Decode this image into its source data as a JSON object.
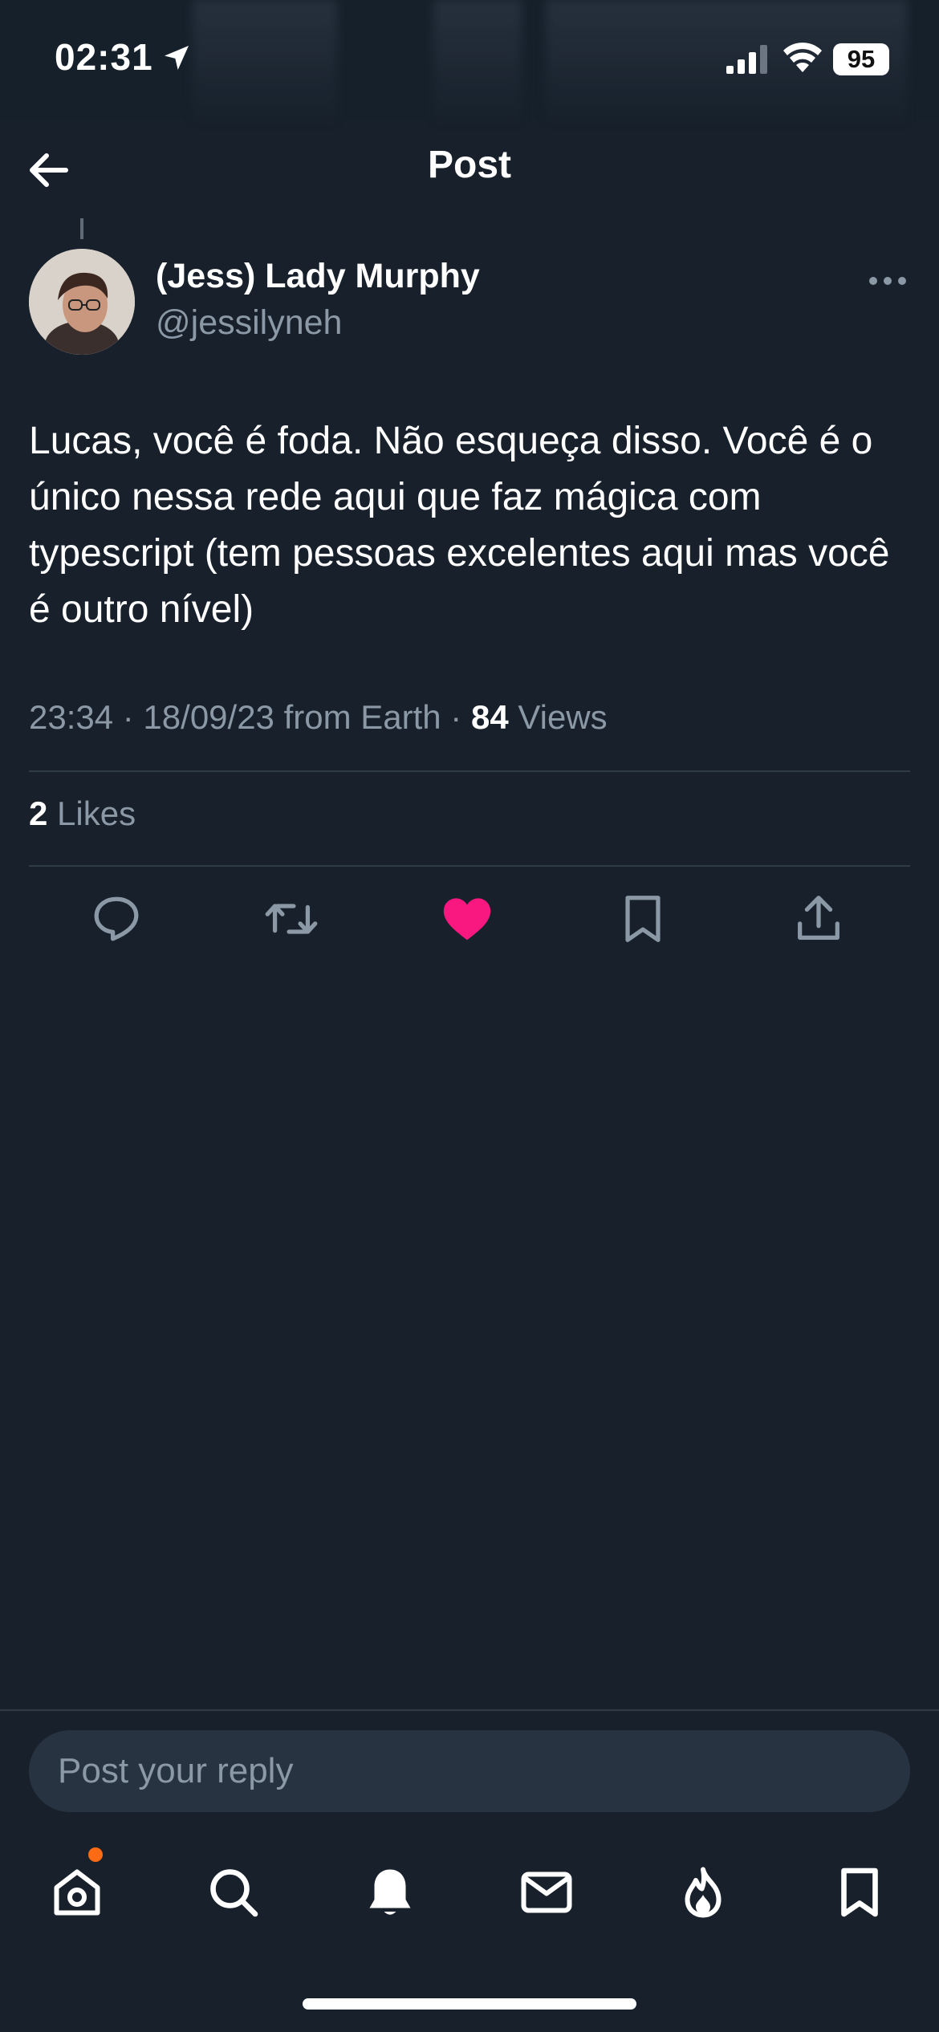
{
  "status_bar": {
    "time": "02:31",
    "battery": "95",
    "icons": [
      "location-arrow-icon",
      "signal-icon",
      "wifi-icon",
      "battery-icon"
    ]
  },
  "header": {
    "title": "Post",
    "back_icon": "arrow-left-icon"
  },
  "post": {
    "author_name": "(Jess) Lady Murphy",
    "author_handle": "@jessilyneh",
    "text": "Lucas, você é foda. Não esqueça disso. Você é o único nessa rede aqui que faz mágica com typescript  (tem pessoas excelentes aqui mas você é outro nível)",
    "timestamp": "23:34 · 18/09/23 from Earth · ",
    "views_count": "84",
    "views_label": " Views",
    "likes_count": "2",
    "likes_label": " Likes",
    "liked": true,
    "like_color": "#f91880"
  },
  "actions": [
    "reply-icon",
    "repost-icon",
    "like-icon",
    "bookmark-icon",
    "share-icon"
  ],
  "reply": {
    "placeholder": "Post your reply"
  },
  "tab_bar": {
    "items": [
      "home-icon",
      "search-icon",
      "notifications-icon",
      "messages-icon",
      "trending-icon",
      "bookmarks-icon"
    ],
    "home_badge_color": "#ff6b14"
  },
  "colors": {
    "background": "#17202b",
    "secondary_text": "#8b98a5",
    "divider": "#2f3b47"
  }
}
